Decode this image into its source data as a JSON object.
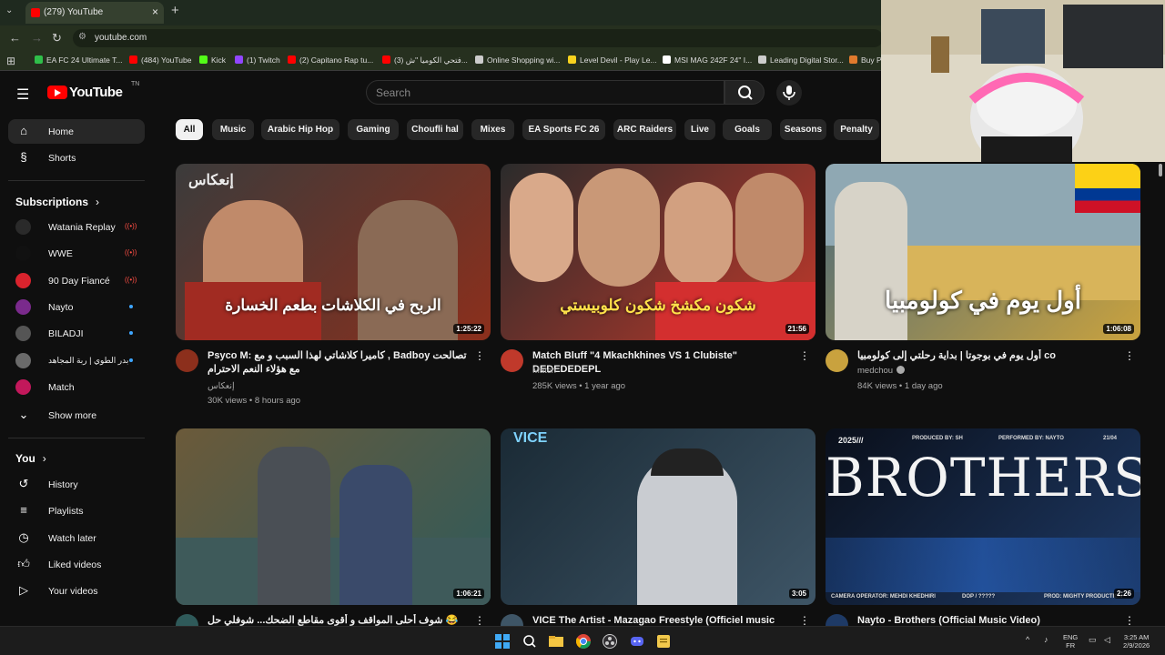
{
  "browser": {
    "tab_title": "(279) YouTube",
    "new_tab_icon": "plus-icon",
    "url": "youtube.com",
    "bookmarks": [
      {
        "label": "EA FC 24 Ultimate T...",
        "color": "#2fbf4a"
      },
      {
        "label": "(484) YouTube",
        "color": "#ff0000"
      },
      {
        "label": "Kick",
        "color": "#53fc18"
      },
      {
        "label": "(1) Twitch",
        "color": "#9146ff"
      },
      {
        "label": "(2) Capitano Rap tu...",
        "color": "#ff0000"
      },
      {
        "label": "(3) فتحي الكوميا \"ش...",
        "color": "#ff0000"
      },
      {
        "label": "Online Shopping wi...",
        "color": "#cccccc"
      },
      {
        "label": "Level Devil - Play Le...",
        "color": "#f7d21e"
      },
      {
        "label": "MSI MAG 242F 24\" I...",
        "color": "#ffffff"
      },
      {
        "label": "Leading Digital Stor...",
        "color": "#cccccc"
      },
      {
        "label": "Buy P",
        "color": "#e07a2d"
      }
    ]
  },
  "header": {
    "logo_text": "YouTube",
    "logo_sup": "TN",
    "search_placeholder": "Search"
  },
  "sidebar": {
    "home": "Home",
    "shorts": "Shorts",
    "subscriptions_title": "Subscriptions",
    "subscriptions": [
      {
        "label": "Watania Replay",
        "status": "live",
        "color": "#2a2a2a"
      },
      {
        "label": "WWE",
        "status": "live",
        "color": "#111111"
      },
      {
        "label": "90 Day Fiancé",
        "status": "live",
        "color": "#d9232d"
      },
      {
        "label": "Nayto",
        "status": "dot",
        "color": "#7a2a8c"
      },
      {
        "label": "BILADJI",
        "status": "dot",
        "color": "#555555"
      },
      {
        "label": "بدر الطوي | ربة المجاهد",
        "status": "dot",
        "color": "#6a6a6a"
      },
      {
        "label": "Match",
        "status": "",
        "color": "#c2185b"
      }
    ],
    "show_more": "Show more",
    "you_title": "You",
    "you_items": [
      "History",
      "Playlists",
      "Watch later",
      "Liked videos",
      "Your videos"
    ]
  },
  "chips": [
    "All",
    "Music",
    "Arabic Hip Hop",
    "Gaming",
    "Choufli hal",
    "Mixes",
    "EA Sports FC 26",
    "ARC Raiders",
    "Live",
    "Goals",
    "Seasons",
    "Penalty"
  ],
  "videos": [
    {
      "title": "Psyco M: كاميرا كلاشاتي لهذا السبب و مع , Badboy تصالحت مع هؤلاء النعم الاحترام",
      "channel": "إنعكاس",
      "meta": "30K views • 8 hours ago",
      "duration": "1:25:22",
      "thumb_text": "الربح في الكلاشات بطعم الخسارة",
      "thumb_tag": "إنعكاس",
      "colors": [
        "#3b3b3b",
        "#8c2f1c"
      ]
    },
    {
      "title": "Match Bluff \"4 Mkachkhines VS 1 Clubiste\" DEDEDEDEPL",
      "channel": "Match",
      "meta": "285K views • 1 year ago",
      "duration": "21:56",
      "thumb_text": "شكون مكشخ شكون كلوبيستي",
      "thumb_tag": "",
      "colors": [
        "#2b2b2b",
        "#c0392b"
      ]
    },
    {
      "title": "أول يوم في بوجوتا | بداية رحلتي إلى كولومبيا co",
      "channel": "medchou",
      "meta": "84K views • 1 day ago",
      "duration": "1:06:08",
      "thumb_text": "أول يوم في كولومبيا",
      "thumb_tag": "",
      "colors": [
        "#4c6a7a",
        "#c9a23e"
      ]
    },
    {
      "title": "شوف أحلى المواقف و أقوى مقاطع الضحك... شوفلي حل 😂 💖",
      "channel": "",
      "meta": "",
      "duration": "1:06:21",
      "thumb_text": "",
      "thumb_tag": "",
      "colors": [
        "#6b5a3a",
        "#2f5a5a"
      ]
    },
    {
      "title": "VICE The Artist - Mazagao Freestyle (Officiel music",
      "channel": "",
      "meta": "",
      "duration": "3:05",
      "thumb_text": "VICE",
      "thumb_tag": "",
      "colors": [
        "#1a2a35",
        "#3e5566"
      ]
    },
    {
      "title": "Nayto - Brothers (Official Music Video)",
      "channel": "",
      "meta": "",
      "duration": "2:26",
      "thumb_text": "BROTHERS",
      "thumb_tag": "2025///",
      "thumb_credits": [
        "PRODUCED BY: SH",
        "PERFORMED BY: NAYTO",
        "21/04",
        "CAMERA OPERATOR: MEHDI KHEDHIRI",
        "DOP / ?????",
        "PROD: MIGHTY PRODUCTION"
      ],
      "colors": [
        "#0a0f1a",
        "#1e3a66"
      ]
    }
  ],
  "taskbar": {
    "lang_top": "ENG",
    "lang_bottom": "FR",
    "time": "3:25 AM",
    "date": "2/9/2026"
  }
}
